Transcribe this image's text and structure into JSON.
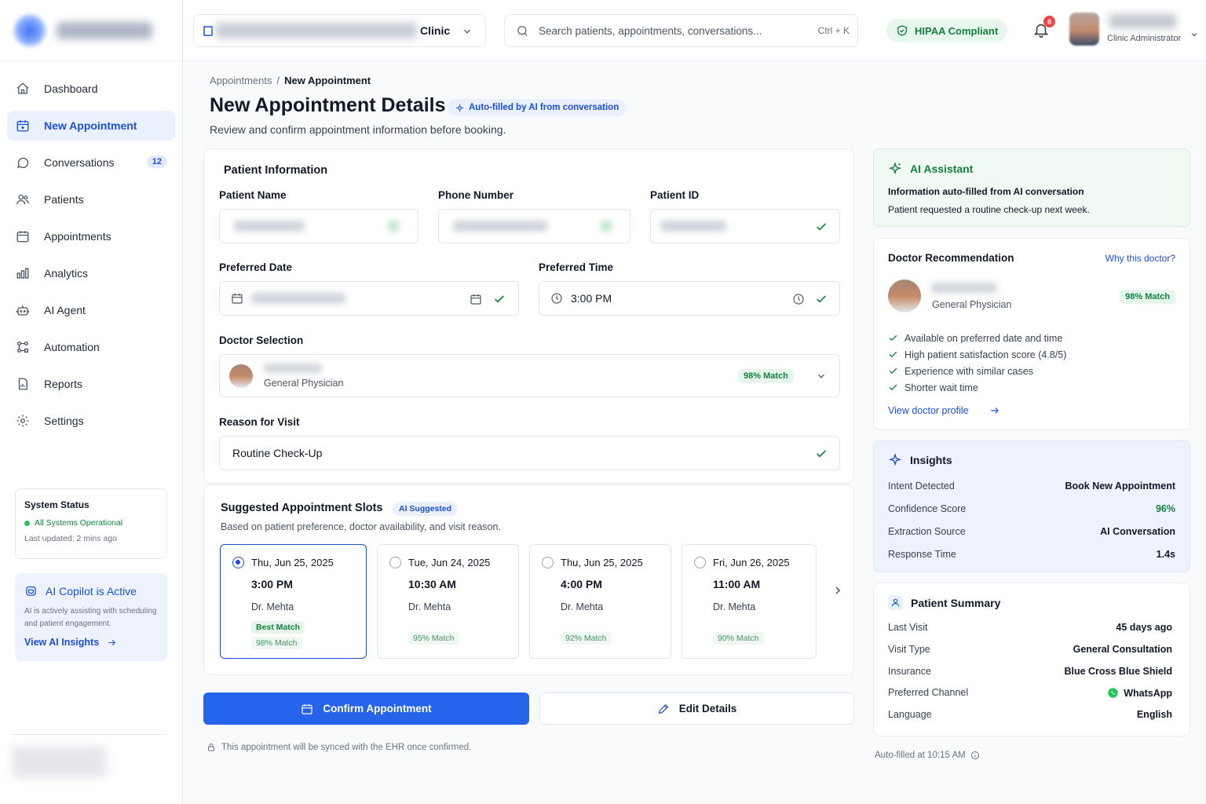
{
  "colors": {
    "accent": "#1d4ed8",
    "primary_button": "#2563eb",
    "success": "#15803d",
    "danger": "#ef4444"
  },
  "sidebar": {
    "items": [
      {
        "label": "Dashboard",
        "icon": "home-icon"
      },
      {
        "label": "New Appointment",
        "icon": "calendar-icon",
        "active": true
      },
      {
        "label": "Conversations",
        "icon": "chat-bubble-icon",
        "badge": "12"
      },
      {
        "label": "Patients",
        "icon": "users-icon"
      },
      {
        "label": "Appointments",
        "icon": "calendar-icon"
      },
      {
        "label": "Analytics",
        "icon": "bar-chart-icon"
      },
      {
        "label": "AI Agent",
        "icon": "robot-icon"
      },
      {
        "label": "Automation",
        "icon": "workflow-icon"
      },
      {
        "label": "Reports",
        "icon": "report-icon"
      },
      {
        "label": "Settings",
        "icon": "gear-icon"
      }
    ],
    "status": {
      "title": "System Status",
      "state": "All Systems Operational",
      "updated": "Last updated: 2 mins ago"
    },
    "copilot": {
      "title": "AI Copilot is Active",
      "desc": "AI is actively assisting with scheduling and patient engagement.",
      "link": "View AI Insights"
    }
  },
  "topbar": {
    "clinic_label": "Clinic",
    "search_placeholder": "Search patients, appointments, conversations...",
    "search_shortcut": "Ctrl + K",
    "hipaa": "HIPAA Compliant",
    "notif_count": "8",
    "user_role": "Clinic Administrator"
  },
  "header": {
    "breadcrumb_parent": "Appointments",
    "breadcrumb_sep": "/",
    "breadcrumb_current": "New Appointment",
    "title": "New Appointment Details",
    "ai_chip": "Auto-filled by AI from conversation",
    "subtitle": "Review and confirm appointment information before booking."
  },
  "patient_form": {
    "section_title": "Patient Information",
    "name_label": "Patient Name",
    "phone_label": "Phone Number",
    "id_label": "Patient ID",
    "date_label": "Preferred Date",
    "time_label": "Preferred Time",
    "time_value": "3:00 PM",
    "doctor_label": "Doctor Selection",
    "doctor_specialty": "General Physician",
    "doctor_match": "98% Match",
    "reason_label": "Reason for Visit",
    "reason_value": "Routine Check-Up"
  },
  "slots": {
    "title": "Suggested Appointment Slots",
    "chip": "AI Suggested",
    "subtitle": "Based on patient preference, doctor availability, and visit reason.",
    "items": [
      {
        "date": "Thu, Jun 25, 2025",
        "time": "3:00 PM",
        "doctor": "Dr. Mehta",
        "best": "Best Match",
        "match": "98% Match",
        "selected": true
      },
      {
        "date": "Tue, Jun 24, 2025",
        "time": "10:30 AM",
        "doctor": "Dr. Mehta",
        "match": "95% Match"
      },
      {
        "date": "Thu, Jun 25, 2025",
        "time": "4:00 PM",
        "doctor": "Dr. Mehta",
        "match": "92% Match"
      },
      {
        "date": "Fri, Jun 26, 2025",
        "time": "11:00 AM",
        "doctor": "Dr. Mehta",
        "match": "90% Match"
      }
    ]
  },
  "actions": {
    "confirm": "Confirm Appointment",
    "edit": "Edit Details",
    "ehr_note": "This appointment will be synced with the EHR once confirmed."
  },
  "ai_assistant": {
    "title": "AI Assistant",
    "line1": "Information auto-filled from AI conversation",
    "line2": "Patient requested a routine check-up next week."
  },
  "doctor_rec": {
    "title": "Doctor Recommendation",
    "why": "Why this doctor?",
    "specialty": "General Physician",
    "match": "98% Match",
    "reasons": [
      "Available on preferred date and time",
      "High patient satisfaction score (4.8/5)",
      "Experience with similar cases",
      "Shorter wait time"
    ],
    "link": "View doctor profile"
  },
  "insights": {
    "title": "Insights",
    "rows": [
      {
        "k": "Intent Detected",
        "v": "Book New Appointment"
      },
      {
        "k": "Confidence Score",
        "v": "96%"
      },
      {
        "k": "Extraction Source",
        "v": "AI Conversation"
      },
      {
        "k": "Response Time",
        "v": "1.4s"
      }
    ]
  },
  "patient_summary": {
    "title": "Patient Summary",
    "rows": [
      {
        "k": "Last Visit",
        "v": "45 days ago"
      },
      {
        "k": "Visit Type",
        "v": "General Consultation"
      },
      {
        "k": "Insurance",
        "v": "Blue Cross Blue Shield"
      },
      {
        "k": "Preferred Channel",
        "v": "WhatsApp"
      },
      {
        "k": "Language",
        "v": "English"
      }
    ]
  },
  "footer_note": "Auto-filled at 10:15 AM"
}
